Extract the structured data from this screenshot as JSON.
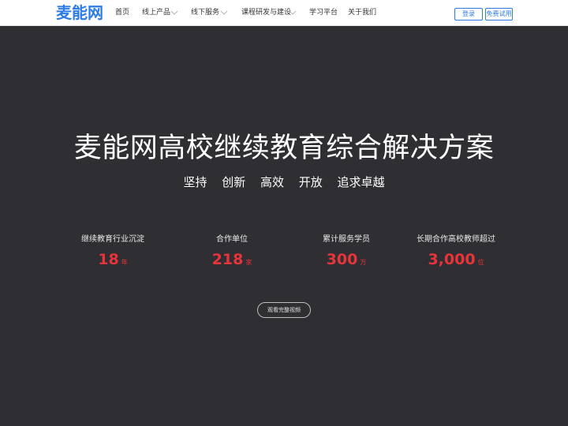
{
  "nav": {
    "logo": "麦能网",
    "items": [
      {
        "label": "首页",
        "has_dropdown": false
      },
      {
        "label": "线上产品",
        "has_dropdown": true
      },
      {
        "label": "线下服务",
        "has_dropdown": true
      },
      {
        "label": "课程研发与建设",
        "has_dropdown": true
      },
      {
        "label": "学习平台",
        "has_dropdown": false
      },
      {
        "label": "关于我们",
        "has_dropdown": false
      }
    ],
    "login_label": "登录",
    "trial_label": "免费试用",
    "dropdown_icon": "chevron-down-icon"
  },
  "hero": {
    "title": "麦能网高校继续教育综合解决方案",
    "subtitle": "坚持 创新 高效 开放 追求卓越"
  },
  "stats": [
    {
      "label": "继续教育行业沉淀",
      "value": "18",
      "unit": "年"
    },
    {
      "label": "合作单位",
      "value": "218",
      "unit": "家"
    },
    {
      "label": "累计服务学员",
      "value": "300",
      "unit": "万"
    },
    {
      "label": "长期合作高校教师超过",
      "value": "3,000",
      "unit": "位"
    }
  ],
  "video_button_label": "观看完整视频",
  "colors": {
    "brand": "#2d7be5",
    "background": "#2f2e33",
    "accent": "#e7343a"
  }
}
